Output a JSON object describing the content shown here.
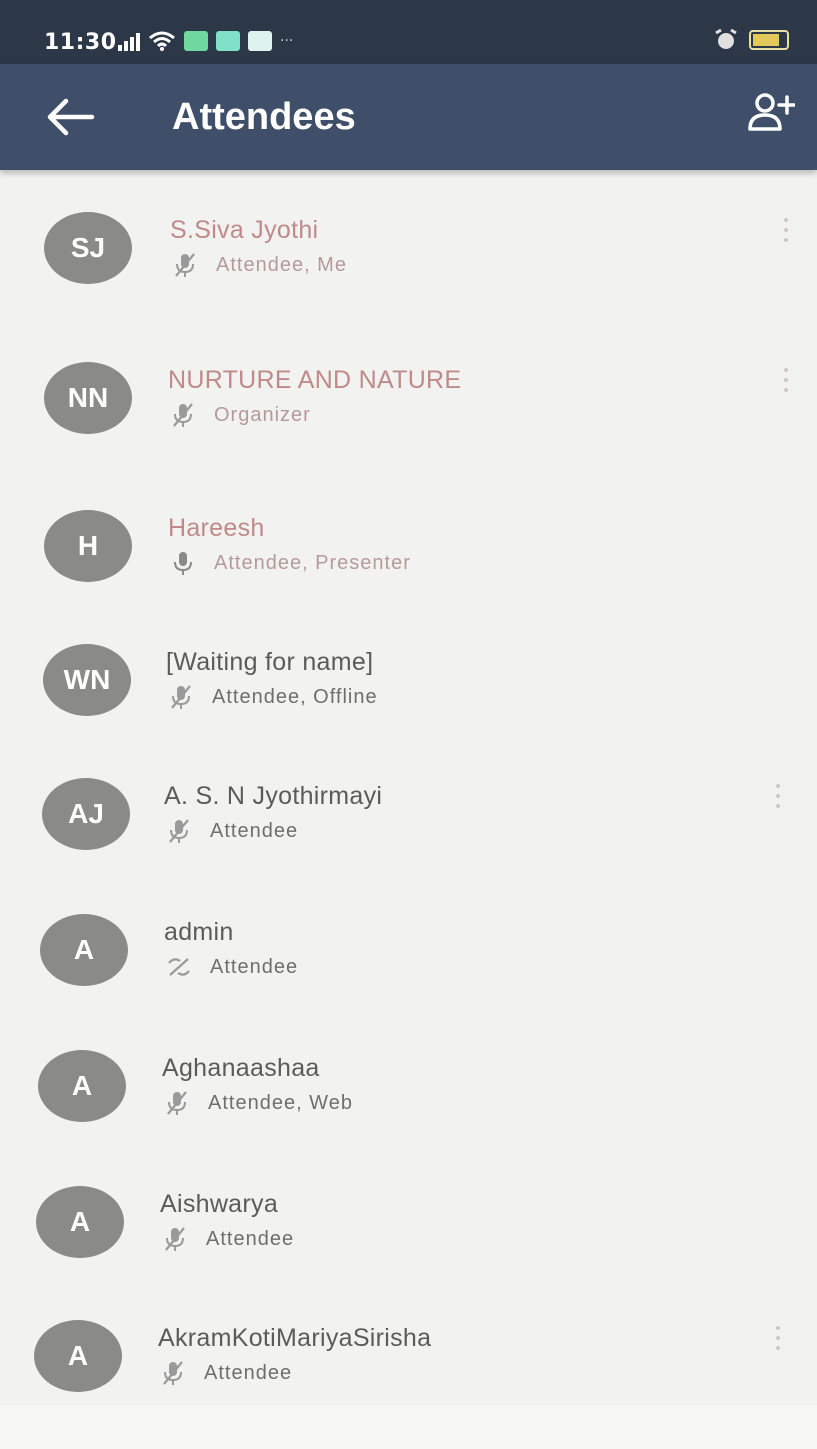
{
  "status_bar": {
    "time": "11:30",
    "battery_level": 0.8
  },
  "app_bar": {
    "title": "Attendees",
    "back_icon": "arrow-left-icon",
    "add_icon": "add-person-icon"
  },
  "colors": {
    "app_bar": "#3f4e69",
    "status_bar": "#2c3748",
    "avatar": "#8a8a88",
    "background": "#f2f2f0"
  },
  "attendees": [
    {
      "initials": "SJ",
      "name": "S.Siva Jyothi",
      "role": "Attendee, Me",
      "mic": "mic-off-icon",
      "has_menu": true
    },
    {
      "initials": "NN",
      "name": "NURTURE AND NATURE",
      "role": "Organizer",
      "mic": "mic-off-icon",
      "has_menu": true
    },
    {
      "initials": "H",
      "name": "Hareesh",
      "role": "Attendee, Presenter",
      "mic": "mic-on-icon",
      "has_menu": false
    },
    {
      "initials": "WN",
      "name": "[Waiting for name]",
      "role": "Attendee, Offline",
      "mic": "mic-off-icon",
      "has_menu": false
    },
    {
      "initials": "AJ",
      "name": "A. S. N Jyothirmayi",
      "role": "Attendee",
      "mic": "mic-off-icon",
      "has_menu": true
    },
    {
      "initials": "A",
      "name": "admin",
      "role": "Attendee",
      "mic": "phone-off-icon",
      "has_menu": false
    },
    {
      "initials": "A",
      "name": "Aghanaashaa",
      "role": "Attendee, Web",
      "mic": "mic-off-icon",
      "has_menu": false
    },
    {
      "initials": "A",
      "name": "Aishwarya",
      "role": "Attendee",
      "mic": "mic-off-icon",
      "has_menu": false
    },
    {
      "initials": "A",
      "name": "AkramKotiMariyaSirisha",
      "role": "Attendee",
      "mic": "mic-off-icon",
      "has_menu": true
    }
  ]
}
